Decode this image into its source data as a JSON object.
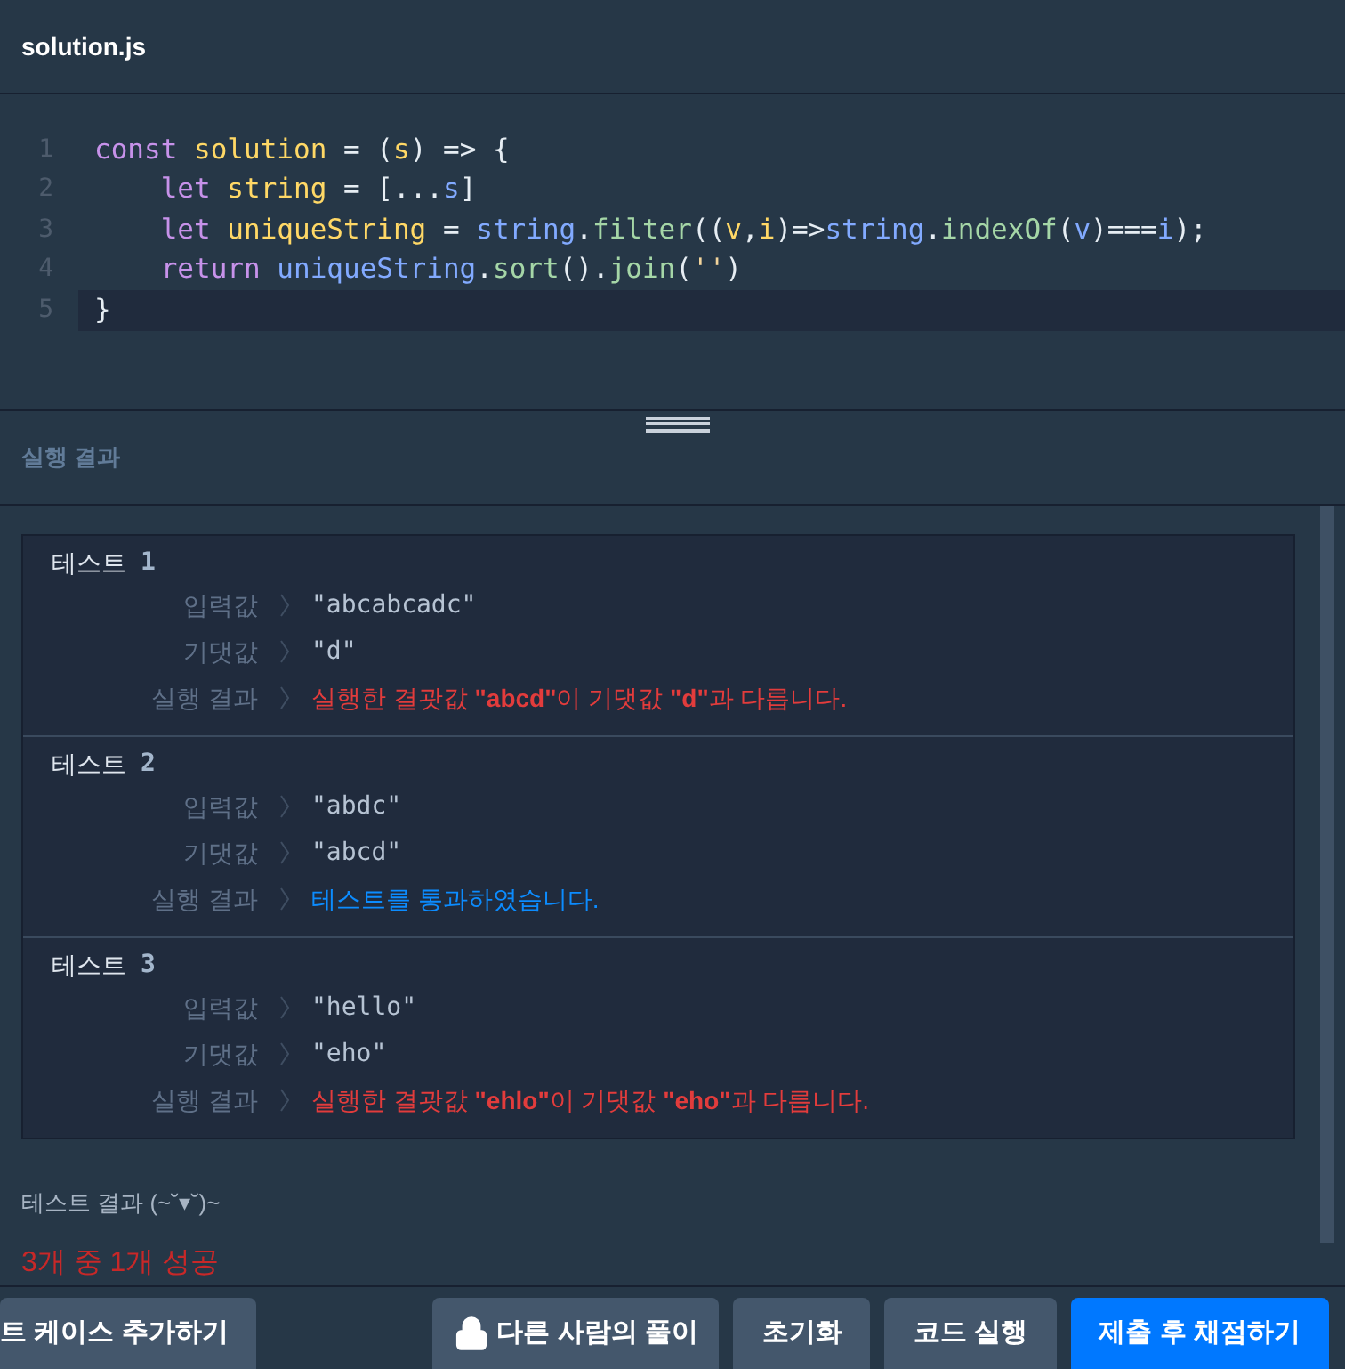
{
  "file_tab": {
    "title": "solution.js"
  },
  "editor": {
    "lines": [
      {
        "number": "1",
        "current": false,
        "tokens": [
          {
            "kind": "keyword",
            "text": "const "
          },
          {
            "kind": "name",
            "text": "solution"
          },
          {
            "kind": "plain",
            "text": " = ("
          },
          {
            "kind": "name",
            "text": "s"
          },
          {
            "kind": "plain",
            "text": ") => {"
          }
        ]
      },
      {
        "number": "2",
        "current": false,
        "tokens": [
          {
            "kind": "keyword",
            "text": "    let "
          },
          {
            "kind": "name",
            "text": "string"
          },
          {
            "kind": "plain",
            "text": " = [..."
          },
          {
            "kind": "var",
            "text": "s"
          },
          {
            "kind": "plain",
            "text": "]"
          }
        ]
      },
      {
        "number": "3",
        "current": false,
        "tokens": [
          {
            "kind": "keyword",
            "text": "    let "
          },
          {
            "kind": "name",
            "text": "uniqueString"
          },
          {
            "kind": "plain",
            "text": " = "
          },
          {
            "kind": "var",
            "text": "string"
          },
          {
            "kind": "plain",
            "text": "."
          },
          {
            "kind": "method",
            "text": "filter"
          },
          {
            "kind": "plain",
            "text": "(("
          },
          {
            "kind": "name",
            "text": "v"
          },
          {
            "kind": "plain",
            "text": ","
          },
          {
            "kind": "name",
            "text": "i"
          },
          {
            "kind": "plain",
            "text": ")=>"
          },
          {
            "kind": "var",
            "text": "string"
          },
          {
            "kind": "plain",
            "text": "."
          },
          {
            "kind": "method",
            "text": "indexOf"
          },
          {
            "kind": "plain",
            "text": "("
          },
          {
            "kind": "var",
            "text": "v"
          },
          {
            "kind": "plain",
            "text": ")==="
          },
          {
            "kind": "var",
            "text": "i"
          },
          {
            "kind": "plain",
            "text": ");"
          }
        ]
      },
      {
        "number": "4",
        "current": false,
        "tokens": [
          {
            "kind": "keyword",
            "text": "    return "
          },
          {
            "kind": "var",
            "text": "uniqueString"
          },
          {
            "kind": "plain",
            "text": "."
          },
          {
            "kind": "method",
            "text": "sort"
          },
          {
            "kind": "plain",
            "text": "()."
          },
          {
            "kind": "method",
            "text": "join"
          },
          {
            "kind": "plain",
            "text": "("
          },
          {
            "kind": "string",
            "text": "''"
          },
          {
            "kind": "plain",
            "text": ")"
          }
        ]
      },
      {
        "number": "5",
        "current": true,
        "tokens": [
          {
            "kind": "plain",
            "text": "}"
          }
        ]
      }
    ]
  },
  "results_header": {
    "title": "실행 결과"
  },
  "tests": [
    {
      "title": "테스트",
      "number": "1",
      "rows": [
        {
          "label": "입력값",
          "value": "\"abcabcadc\""
        },
        {
          "label": "기댓값",
          "value": "\"d\""
        }
      ],
      "result_label": "실행 결과",
      "result": "실행한 결괏값 **\"abcd\"**이 기댓값 **\"d\"**과 다릅니다.",
      "passed": false
    },
    {
      "title": "테스트",
      "number": "2",
      "rows": [
        {
          "label": "입력값",
          "value": "\"abdc\""
        },
        {
          "label": "기댓값",
          "value": "\"abcd\""
        }
      ],
      "result_label": "실행 결과",
      "result": "테스트를 통과하였습니다.",
      "passed": true
    },
    {
      "title": "테스트",
      "number": "3",
      "rows": [
        {
          "label": "입력값",
          "value": "\"hello\""
        },
        {
          "label": "기댓값",
          "value": "\"eho\""
        }
      ],
      "result_label": "실행 결과",
      "result": "실행한 결괏값 **\"ehlo\"**이 기댓값 **\"eho\"**과 다릅니다.",
      "passed": false
    }
  ],
  "summary": {
    "title": "테스트 결과 (~˘▾˘)~",
    "result": "3개 중 1개 성공",
    "passed": false
  },
  "buttons": [
    {
      "label": "트 케이스 추가하기",
      "kind": "left"
    },
    {
      "label": "다른 사람의 풀이",
      "kind": "locked"
    },
    {
      "label": "초기화",
      "kind": "plain"
    },
    {
      "label": "코드 실행",
      "kind": "plain"
    },
    {
      "label": "제출 후 채점하기",
      "kind": "primary"
    }
  ]
}
